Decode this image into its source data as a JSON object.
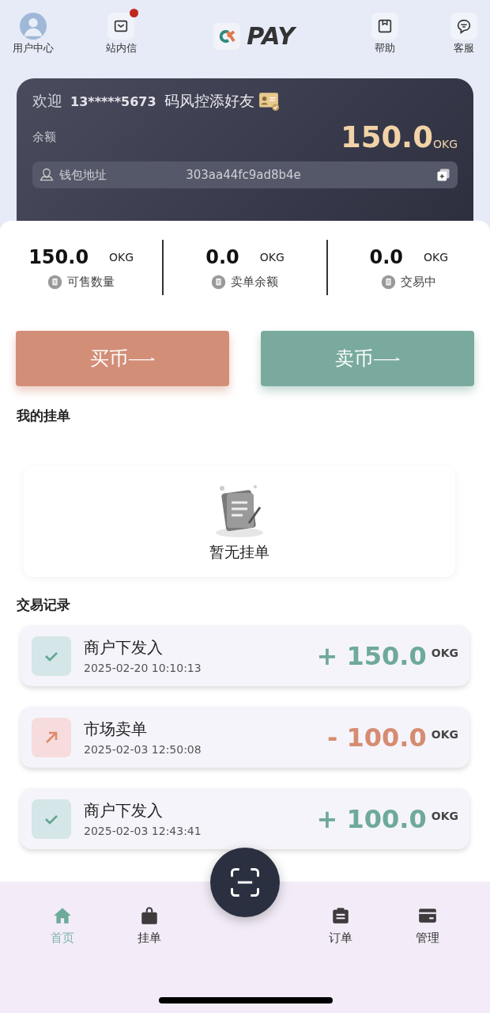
{
  "header": {
    "user": {
      "label": "用户中心"
    },
    "messages": {
      "label": "站内信",
      "unread": true
    },
    "logo": "PAY",
    "help": {
      "label": "帮助"
    },
    "service": {
      "label": "客服"
    }
  },
  "account_card": {
    "welcome": "欢迎",
    "phone": "13*****5673",
    "tag": "码风控添好友",
    "balance_label": "余额",
    "balance": "150.0",
    "unit": "OKG",
    "wallet_label": "钱包地址",
    "wallet_address": "303aa44fc9ad8b4e"
  },
  "stats": [
    {
      "value": "150.0",
      "unit": "OKG",
      "label": "可售数量"
    },
    {
      "value": "0.0",
      "unit": "OKG",
      "label": "卖单余额"
    },
    {
      "value": "0.0",
      "unit": "OKG",
      "label": "交易中"
    }
  ],
  "actions": [
    {
      "kind": "buy",
      "label": "买币"
    },
    {
      "kind": "sell",
      "label": "卖币"
    }
  ],
  "my_orders": {
    "title": "我的挂单",
    "empty_text": "暂无挂单"
  },
  "records": {
    "title": "交易记录",
    "items": [
      {
        "kind": "income",
        "title": "商户下发入",
        "time": "2025-02-20 10:10:13",
        "amount": "+ 150.0",
        "unit": "OKG"
      },
      {
        "kind": "sell",
        "title": "市场卖单",
        "time": "2025-02-03 12:50:08",
        "amount": "- 100.0",
        "unit": "OKG"
      },
      {
        "kind": "income",
        "title": "商户下发入",
        "time": "2025-02-03 12:43:41",
        "amount": "+ 100.0",
        "unit": "OKG"
      }
    ]
  },
  "tab_bar": {
    "items": [
      {
        "kind": "home",
        "label": "首页",
        "selected": true
      },
      {
        "kind": "bag",
        "label": "挂单",
        "selected": false
      },
      {
        "kind": "orders",
        "label": "订单",
        "selected": false
      },
      {
        "kind": "card",
        "label": "管理",
        "selected": false
      }
    ]
  }
}
